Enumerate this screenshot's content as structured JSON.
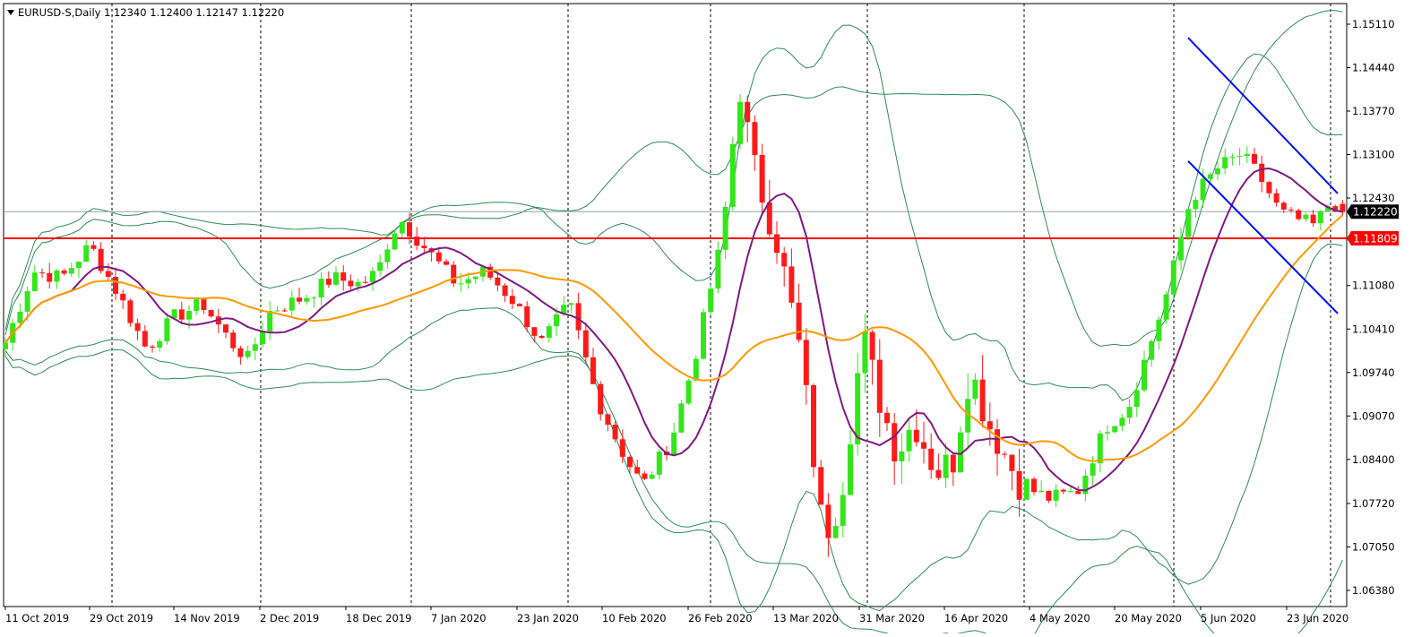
{
  "header": {
    "symbol": "EURUSD-S,Daily",
    "ohlc": "1.12340 1.12400 1.12147 1.12220"
  },
  "colors": {
    "bull": "#33e61a",
    "bear": "#ff1a1a",
    "ma_fast": "#7f1a7f",
    "ma_slow": "#ff9900",
    "bands": "#2e8b57",
    "channel": "#0010ff",
    "support": "#ff0000",
    "current_line": "#8fa2b4",
    "current_tag_bg": "#000000",
    "support_tag_bg": "#ff0000"
  },
  "chart_data": {
    "type": "candlestick",
    "symbol": "EURUSD-S",
    "timeframe": "Daily",
    "y_axis": {
      "ticks": [
        "1.15110",
        "1.14440",
        "1.13770",
        "1.13100",
        "1.12430",
        "1.11080",
        "1.10410",
        "1.09740",
        "1.09070",
        "1.08400",
        "1.07720",
        "1.07050",
        "1.06380"
      ],
      "ylim": [
        1.0602,
        1.1535
      ]
    },
    "x_axis": {
      "tick_labels": [
        "11 Oct 2019",
        "29 Oct 2019",
        "14 Nov 2019",
        "2 Dec 2019",
        "18 Dec 2019",
        "7 Jan 2020",
        "23 Jan 2020",
        "10 Feb 2020",
        "26 Feb 2020",
        "13 Mar 2020",
        "31 Mar 2020",
        "16 Apr 2020",
        "4 May 2020",
        "20 May 2020",
        "5 Jun 2020",
        "23 Jun 2020"
      ],
      "month_separators": [
        "Nov 2019",
        "Dec 2019",
        "Jan 2020",
        "Feb 2020",
        "Mar 2020",
        "Apr 2020",
        "May 2020",
        "Jun 2020"
      ]
    },
    "current_price": "1.12220",
    "support_level": "1.11809",
    "indicators": [
      "Bollinger Bands",
      "Moving Average (fast)",
      "Moving Average (slow)"
    ],
    "trend_channel": {
      "upper": {
        "from": [
          "27 May 2020",
          1.149
        ],
        "to": [
          "30 Jun 2020",
          1.125
        ]
      },
      "lower": {
        "from": [
          "27 May 2020",
          1.13
        ],
        "to": [
          "30 Jun 2020",
          1.1065
        ]
      }
    },
    "grid": false,
    "legend": "none"
  }
}
